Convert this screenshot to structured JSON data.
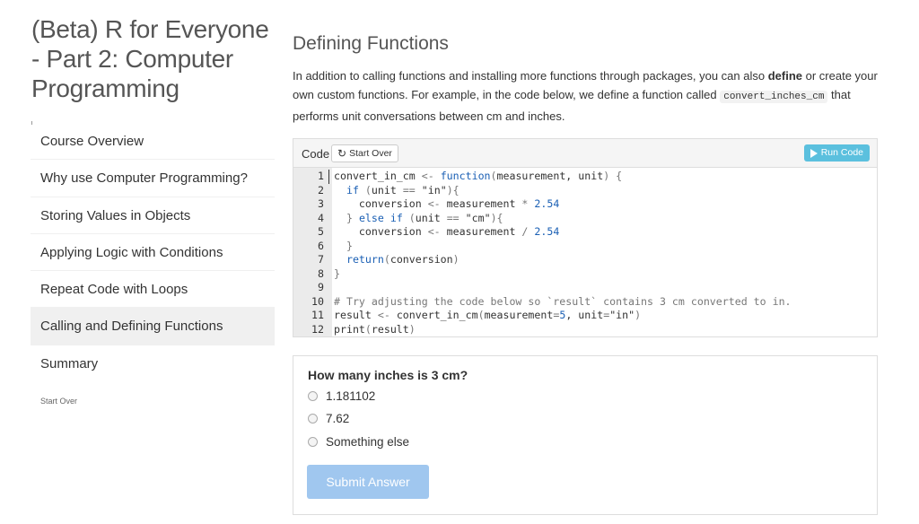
{
  "sidebar": {
    "course_title": "(Beta) R for Everyone - Part 2: Computer Programming",
    "items": [
      {
        "label": "Course Overview",
        "active": false
      },
      {
        "label": "Why use Computer Programming?",
        "active": false
      },
      {
        "label": "Storing Values in Objects",
        "active": false
      },
      {
        "label": "Applying Logic with Conditions",
        "active": false
      },
      {
        "label": "Repeat Code with Loops",
        "active": false
      },
      {
        "label": "Calling and Defining Functions",
        "active": true
      },
      {
        "label": "Summary",
        "active": false
      }
    ],
    "start_over": "Start Over"
  },
  "main": {
    "section_title": "Defining Functions",
    "intro": {
      "part1": "In addition to calling functions and installing more functions through packages, you can also ",
      "bold": "define",
      "part2": " or create your own custom functions. For example, in the code below, we define a function called ",
      "code": "convert_inches_cm",
      "part3": " that performs unit conversations between cm and inches."
    }
  },
  "code_panel": {
    "label": "Code",
    "start_over_label": "Start Over",
    "run_code_label": "Run Code",
    "lines": [
      "convert_in_cm <- function(measurement, unit) {",
      "  if (unit == \"in\"){",
      "    conversion <- measurement * 2.54",
      "  } else if (unit == \"cm\"){",
      "    conversion <- measurement / 2.54",
      "  }",
      "  return(conversion)",
      "}",
      "",
      "# Try adjusting the code below so `result` contains 3 cm converted to in.",
      "result <- convert_in_cm(measurement=5, unit=\"in\")",
      "print(result)"
    ]
  },
  "quiz": {
    "question": "How many inches is 3 cm?",
    "options": [
      "1.181102",
      "7.62",
      "Something else"
    ],
    "submit_label": "Submit Answer"
  },
  "colors": {
    "run_button": "#5bc0de",
    "submit_button": "#a0c7ef",
    "active_nav": "#f0f0f0",
    "code_keyword": "#1a5fb4"
  },
  "icons": {
    "start_over": "refresh-icon",
    "run_code": "play-icon"
  }
}
